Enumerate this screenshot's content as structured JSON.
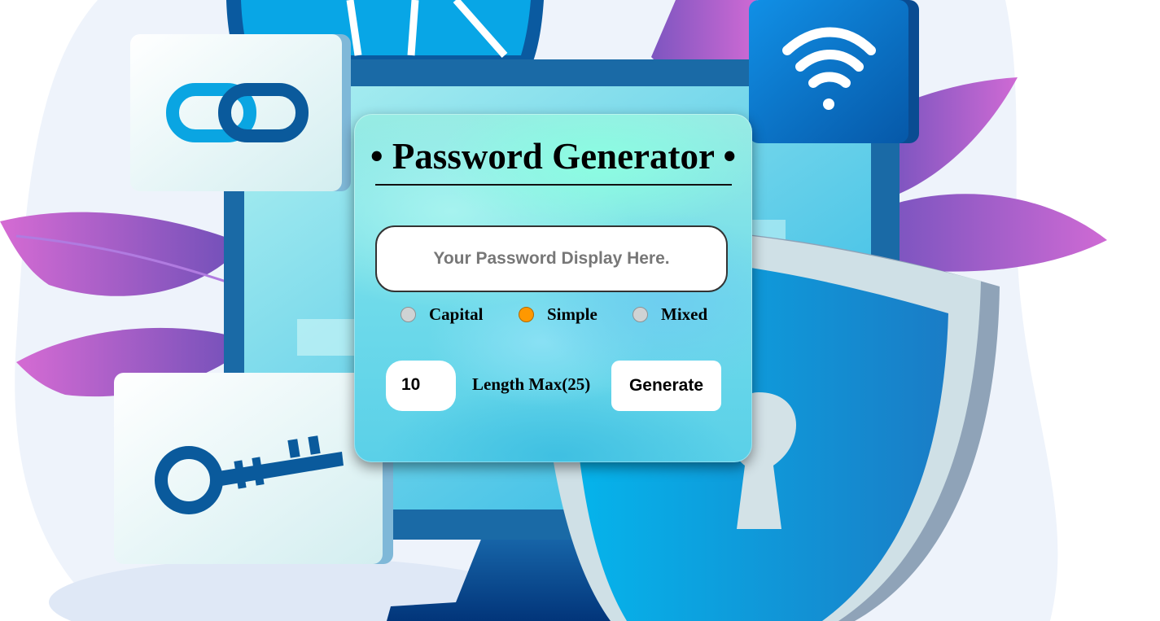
{
  "header": {
    "title": "• Password Generator •"
  },
  "password_display": {
    "placeholder": "Your Password Display Here."
  },
  "options": [
    {
      "label": "Capital",
      "selected": false
    },
    {
      "label": "Simple",
      "selected": true
    },
    {
      "label": "Mixed",
      "selected": false
    }
  ],
  "length": {
    "value": "10",
    "label": "Length Max(25)"
  },
  "generate_label": "Generate",
  "colors": {
    "accent": "#ff9800",
    "primary_blue": "#0a5a9c",
    "light_blue": "#00b3ec",
    "purple": "#b065d0"
  },
  "icons": [
    "link-icon",
    "wifi-icon",
    "key-icon",
    "shield-lock-icon",
    "globe-icon"
  ]
}
